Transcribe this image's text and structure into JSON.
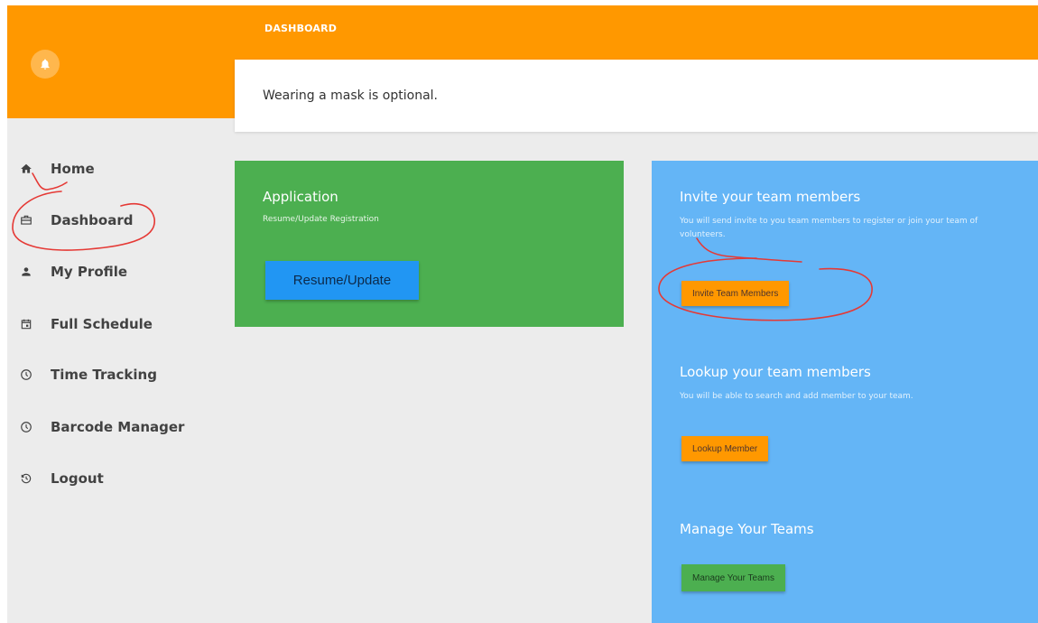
{
  "header": {
    "breadcrumb": "DASHBOARD",
    "notification_icon": "bell-icon"
  },
  "notice": {
    "text": "Wearing a mask is optional."
  },
  "sidebar": {
    "items": [
      {
        "label": "Home",
        "icon": "home-icon"
      },
      {
        "label": "Dashboard",
        "icon": "briefcase-icon"
      },
      {
        "label": "My Profile",
        "icon": "person-icon"
      },
      {
        "label": "Full Schedule",
        "icon": "calendar-icon"
      },
      {
        "label": "Time Tracking",
        "icon": "clock-icon"
      },
      {
        "label": "Barcode Manager",
        "icon": "clock-icon"
      },
      {
        "label": "Logout",
        "icon": "history-icon"
      }
    ]
  },
  "application_card": {
    "title": "Application",
    "subtitle": "Resume/Update Registration",
    "button_label": "Resume/Update"
  },
  "team_card": {
    "invite": {
      "title": "Invite your team members",
      "description": "You will send invite to you team members to register or join your team of volunteers.",
      "button_label": "Invite Team Members"
    },
    "lookup": {
      "title": "Lookup your team members",
      "description": "You will be able to search and add member to your team.",
      "button_label": "Lookup Member"
    },
    "manage": {
      "title": "Manage Your Teams",
      "button_label": "Manage Your Teams"
    }
  },
  "colors": {
    "header": "#ff9800",
    "application_card": "#4caf50",
    "team_card": "#64b5f6",
    "primary_button": "#2196f3",
    "annotation": "#e53935"
  }
}
